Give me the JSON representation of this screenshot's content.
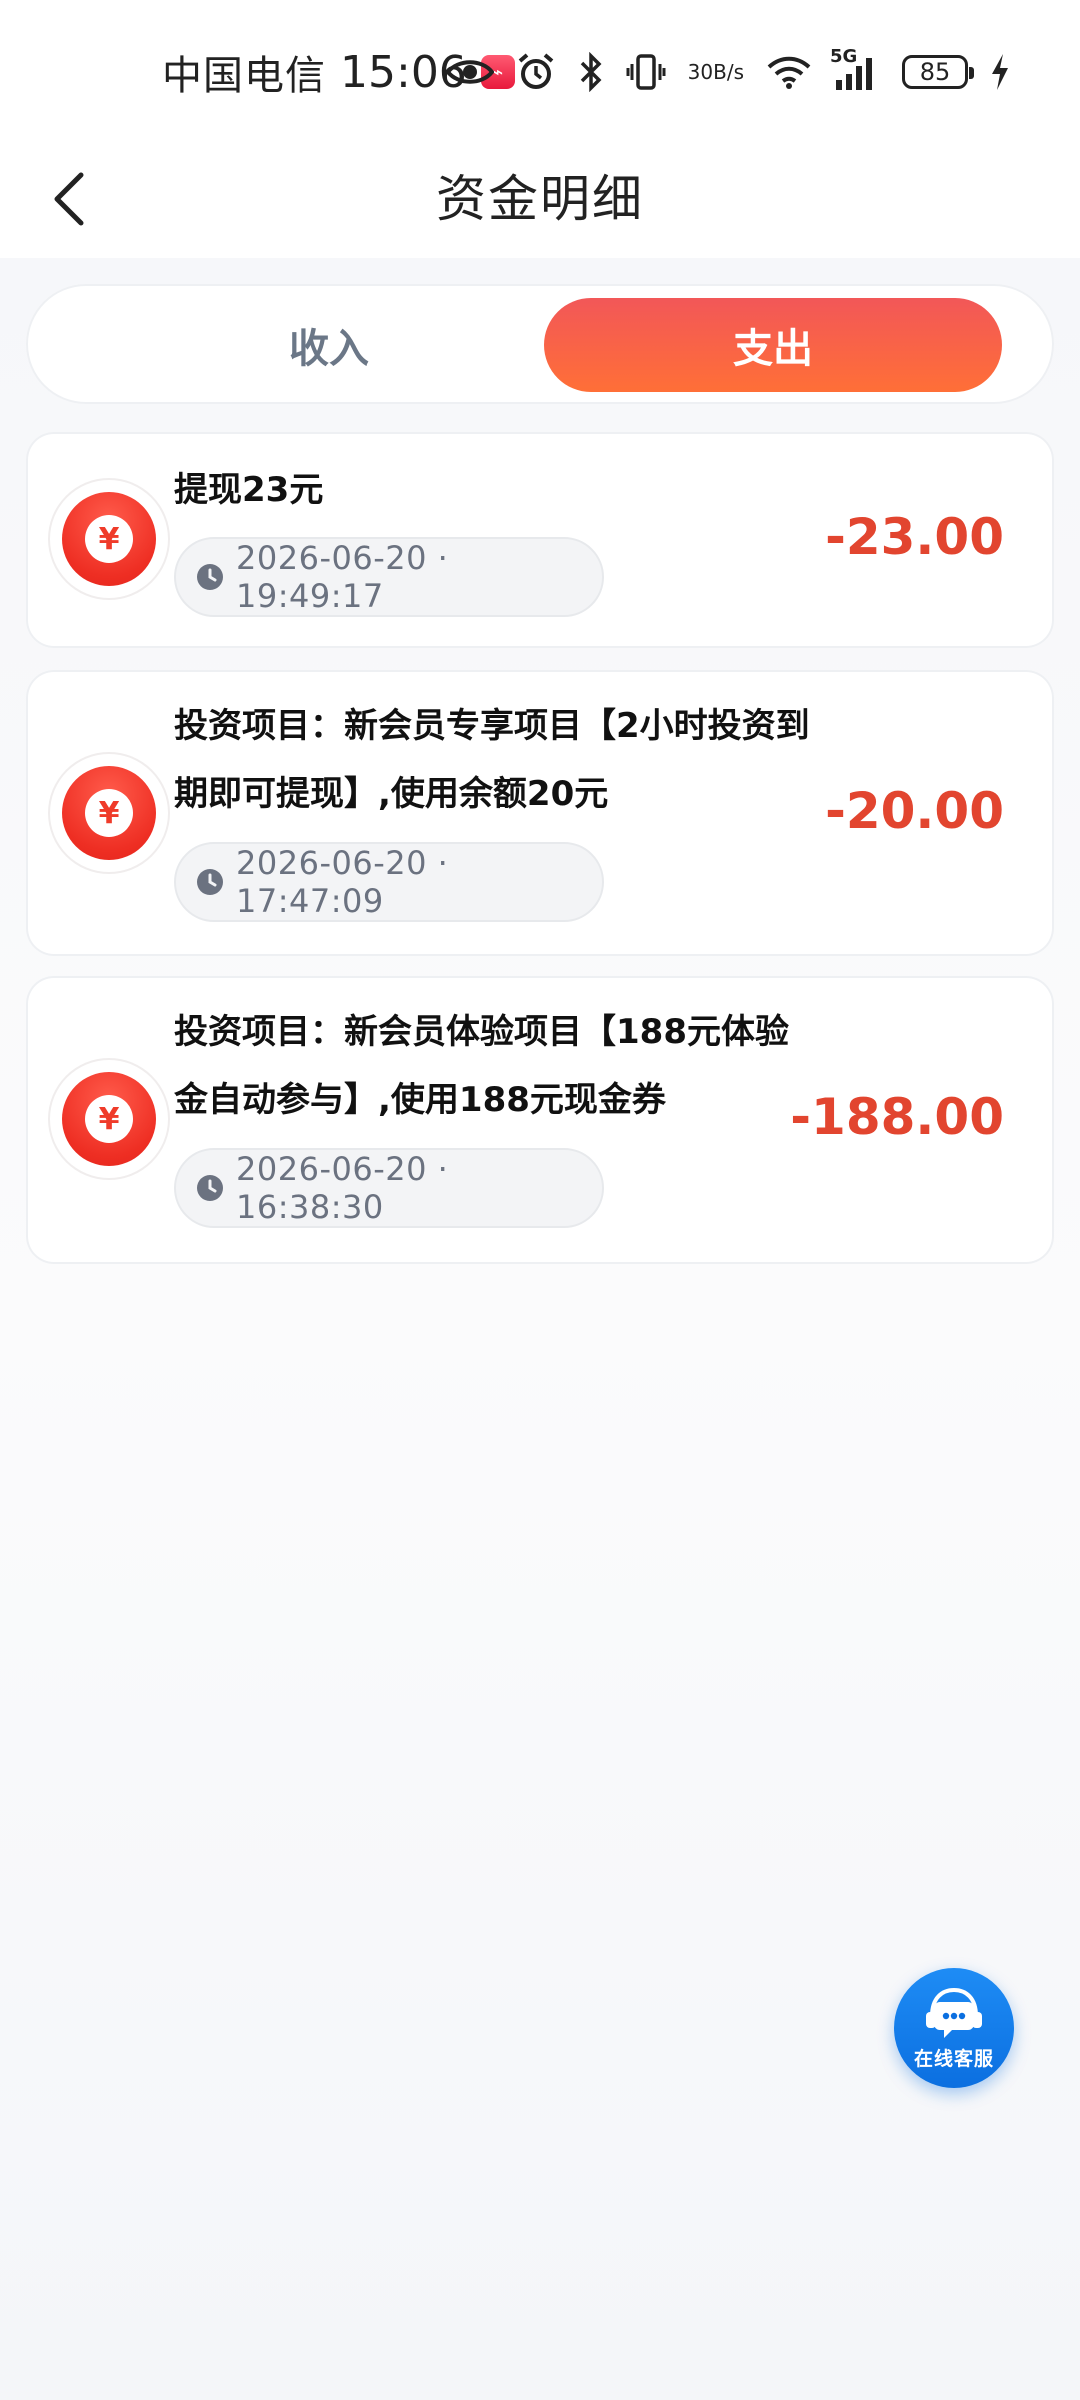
{
  "status_bar": {
    "carrier": "中国电信",
    "time": "15:06",
    "net_speed_value": "30",
    "net_speed_unit": "B/s",
    "network_type": "5G",
    "battery": "85",
    "icons": [
      "app-notification-icon",
      "eye-icon",
      "alarm-icon",
      "bluetooth-icon",
      "vibrate-icon",
      "wifi-icon",
      "signal-icon",
      "battery-icon",
      "charging-icon"
    ]
  },
  "header": {
    "title": "资金明细",
    "back_icon": "chevron-left-icon"
  },
  "tabs": [
    {
      "label": "收入",
      "active": false
    },
    {
      "label": "支出",
      "active": true
    }
  ],
  "records": [
    {
      "title_lines": [
        "提现23元"
      ],
      "time": "2026-06-20 · 19:49:17",
      "amount": "-23.00",
      "icon": "yen-coin-icon"
    },
    {
      "title_lines": [
        "投资项目：新会员专享项目【2小时投资到",
        "期即可提现】,使用余额20元"
      ],
      "time": "2026-06-20 · 17:47:09",
      "amount": "-20.00",
      "icon": "yen-coin-icon"
    },
    {
      "title_lines": [
        "投资项目：新会员体验项目【188元体验",
        "金自动参与】,使用188元现金券"
      ],
      "time": "2026-06-20 · 16:38:30",
      "amount": "-188.00",
      "icon": "yen-coin-icon"
    }
  ],
  "service": {
    "label": "在线客服",
    "icon": "headset-chat-icon"
  },
  "colors": {
    "accent_gradient_start": "#f25758",
    "accent_gradient_end": "#ff6f37",
    "amount_red": "#e2452f",
    "inactive_tab": "#6b7787",
    "service_blue": "#0b6fe0"
  }
}
